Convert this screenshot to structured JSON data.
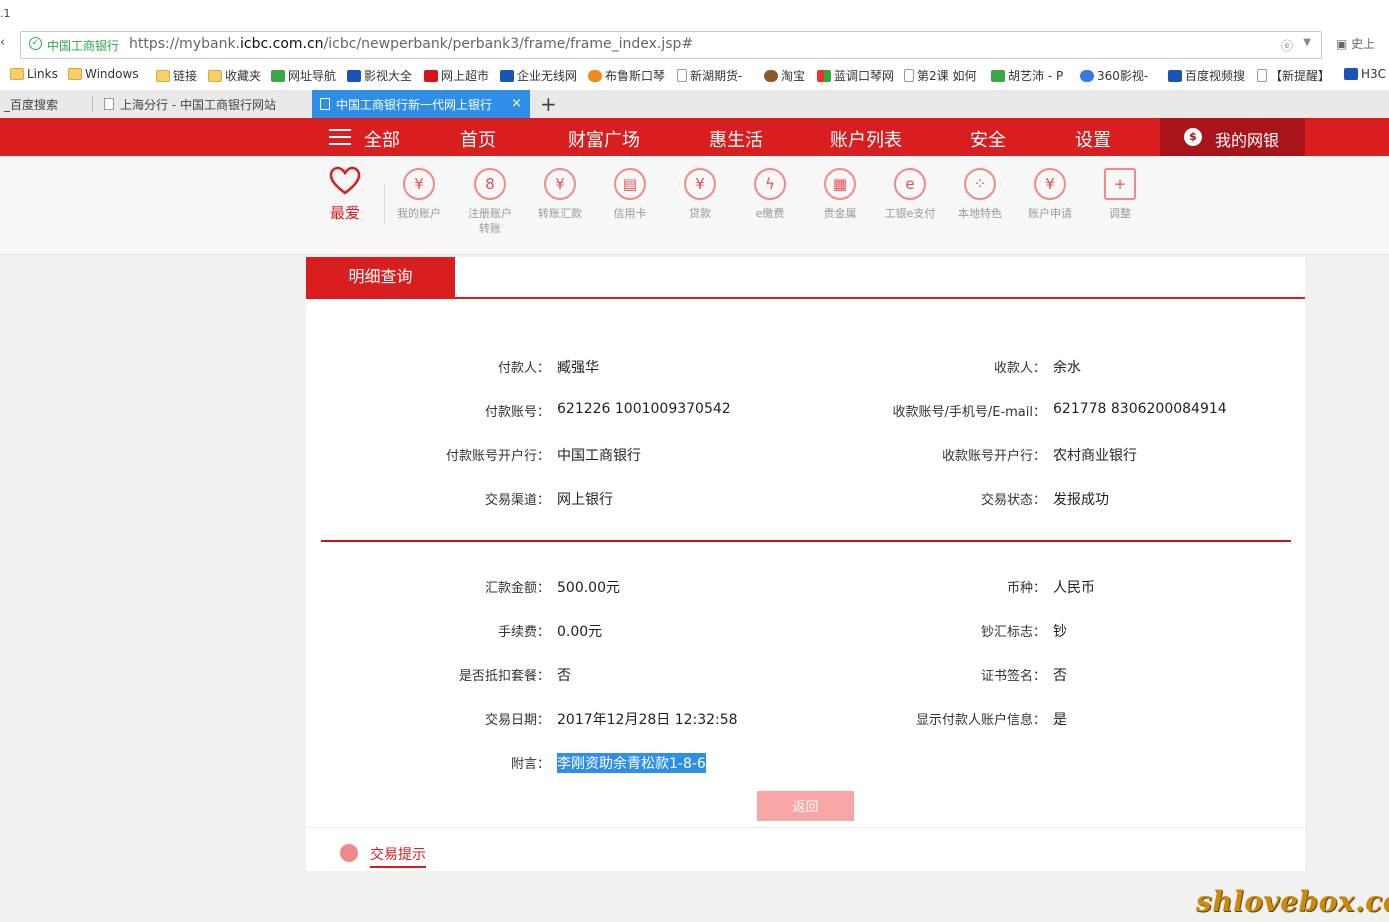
{
  "browser": {
    "version_fragment": ".1",
    "address": {
      "site_label": "中国工商银行",
      "url_prefix": "https://mybank.",
      "url_domain": "icbc.com.cn",
      "url_path": "/icbc/newperbank/perbank3/frame/frame_index.jsp#",
      "ext_label": "史上"
    },
    "bookmarks": [
      {
        "label": "Links",
        "icon": "folder"
      },
      {
        "label": "Windows",
        "icon": "folder"
      },
      {
        "label": "链接",
        "icon": "folder"
      },
      {
        "label": "收藏夹",
        "icon": "folder"
      },
      {
        "label": "网址导航",
        "icon": "green"
      },
      {
        "label": "影视大全",
        "icon": "blue"
      },
      {
        "label": "网上超市",
        "icon": "red"
      },
      {
        "label": "企业无线网",
        "icon": "blue"
      },
      {
        "label": "布鲁斯口琴",
        "icon": "orange"
      },
      {
        "label": "新湖期货-",
        "icon": "page"
      },
      {
        "label": "淘宝",
        "icon": "brown"
      },
      {
        "label": "蓝调口琴网",
        "icon": "multi"
      },
      {
        "label": "第2课 如何",
        "icon": "page"
      },
      {
        "label": "胡艺沛 - P",
        "icon": "green"
      },
      {
        "label": "360影视-",
        "icon": "circle"
      },
      {
        "label": "百度视频搜",
        "icon": "blue"
      },
      {
        "label": "【新提醒】",
        "icon": "page"
      },
      {
        "label": "H3C",
        "icon": "blue"
      }
    ],
    "tabs": [
      {
        "label": "_百度搜索"
      },
      {
        "label": "上海分行 - 中国工商银行网站"
      },
      {
        "label": "中国工商银行新一代网上银行"
      }
    ],
    "new_tab": "+"
  },
  "nav": {
    "all": "全部",
    "items": [
      "首页",
      "财富广场",
      "惠生活",
      "账户列表",
      "安全",
      "设置"
    ],
    "mybank": "我的网银"
  },
  "shortcuts": {
    "favorite": "最爱",
    "items": [
      {
        "label": "我的账户",
        "glyph": "¥"
      },
      {
        "label": "注册账户转账",
        "glyph": "8"
      },
      {
        "label": "转账汇款",
        "glyph": "¥"
      },
      {
        "label": "信用卡",
        "glyph": "▤"
      },
      {
        "label": "贷款",
        "glyph": "¥"
      },
      {
        "label": "e缴费",
        "glyph": "ϟ"
      },
      {
        "label": "贵金属",
        "glyph": "▦"
      },
      {
        "label": "工银e支付",
        "glyph": "e"
      },
      {
        "label": "本地特色",
        "glyph": "⁘"
      },
      {
        "label": "账户申请",
        "glyph": "¥"
      },
      {
        "label": "调整",
        "glyph": "+"
      }
    ]
  },
  "detail": {
    "tab_title": "明细查询",
    "payer_label": "付款人：",
    "payer": "臧强华",
    "payee_label": "收款人：",
    "payee": "余水",
    "payer_acct_label": "付款账号：",
    "payer_acct": "621226 1001009370542",
    "payee_acct_label": "收款账号/手机号/E-mail：",
    "payee_acct": "621778 8306200084914",
    "payer_bank_label": "付款账号开户行：",
    "payer_bank": "中国工商银行",
    "payee_bank_label": "收款账号开户行：",
    "payee_bank": "农村商业银行",
    "channel_label": "交易渠道：",
    "channel": "网上银行",
    "status_label": "交易状态：",
    "status": "发报成功",
    "amount_label": "汇款金额：",
    "amount": "500.00元",
    "currency_label": "币种：",
    "currency": "人民币",
    "fee_label": "手续费：",
    "fee": "0.00元",
    "cash_label": "钞汇标志：",
    "cash": "钞",
    "deduct_label": "是否抵扣套餐：",
    "deduct": "否",
    "cert_label": "证书签名：",
    "cert": "否",
    "date_label": "交易日期：",
    "date": "2017年12月28日 12:32:58",
    "show_payer_label": "显示付款人账户信息：",
    "show_payer": "是",
    "memo_label": "附言：",
    "memo": "李刚资助余青松款1-8-6",
    "back_button": "返回"
  },
  "hint": {
    "label": "交易提示"
  },
  "watermark": "shlovebox.com"
}
